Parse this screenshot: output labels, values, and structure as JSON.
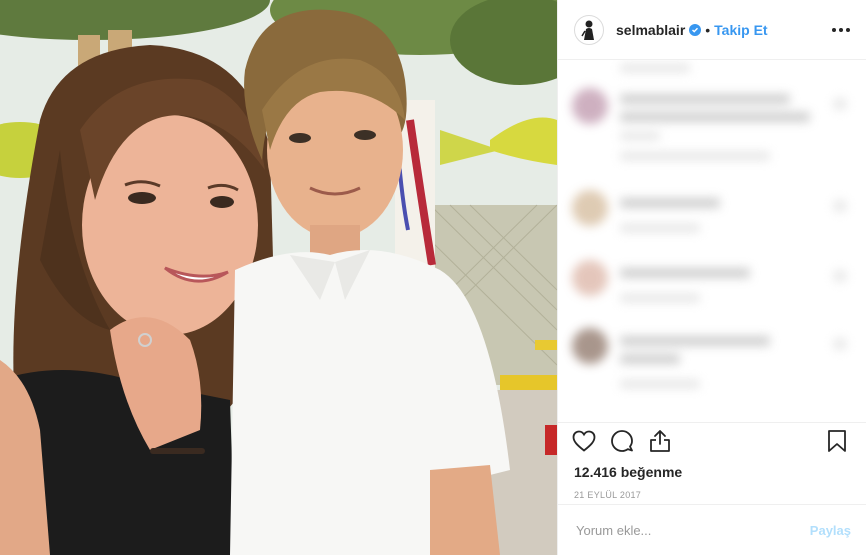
{
  "photo": {
    "description_icon": "photo-image"
  },
  "header": {
    "username": "selmablair",
    "separator": "•",
    "follow_label": "Takip Et",
    "verified_icon": "verified-badge-icon",
    "more_icon": "more-options-icon"
  },
  "actions": {
    "like_icon": "heart-icon",
    "comment_icon": "comment-icon",
    "share_icon": "share-icon",
    "save_icon": "bookmark-icon"
  },
  "likes_text": "12.416 beğenme",
  "date_text": "21 EYLÜL 2017",
  "comment_box": {
    "placeholder": "Yorum ekle...",
    "post_label": "Paylaş"
  },
  "colors": {
    "accent": "#3897f0",
    "post_disabled": "#b2dffc",
    "text": "#262626",
    "muted": "#999999",
    "border": "#efefef"
  }
}
